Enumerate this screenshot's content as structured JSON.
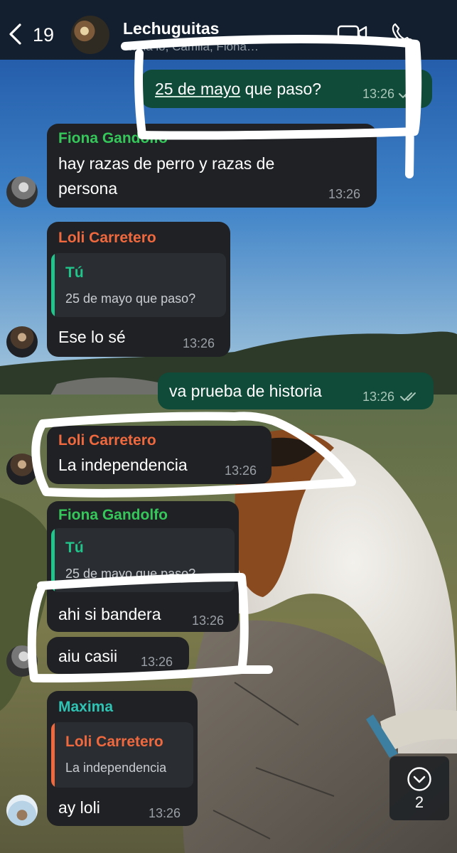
{
  "header": {
    "back_count": "19",
    "title": "Lechuguitas",
    "members": "…ula lo, Camila, Fiona…"
  },
  "colors": {
    "incoming_bubble": "#1f2124",
    "outgoing_bubble": "#0f4b38",
    "fiona": "#35c75a",
    "loli": "#f0693e",
    "maxima": "#2fc3b4",
    "reply_you": "#21c48a"
  },
  "messages": [
    {
      "type": "outgoing",
      "link_text": "25 de mayo",
      "text": " que paso?",
      "time": "13:26",
      "status": "read"
    },
    {
      "type": "incoming",
      "sender": "Fiona Gandolfo",
      "text_line1": "hay razas de perro y razas de",
      "text_line2": "persona",
      "time": "13:26"
    },
    {
      "type": "incoming",
      "sender": "Loli Carretero",
      "reply_author": "Tú",
      "reply_text": "25 de mayo que paso?",
      "text": "Ese lo sé",
      "time": "13:26"
    },
    {
      "type": "outgoing",
      "text": "va prueba de historia",
      "time": "13:26",
      "status": "read"
    },
    {
      "type": "incoming",
      "sender": "Loli Carretero",
      "text": "La independencia",
      "time": "13:26"
    },
    {
      "type": "incoming",
      "sender": "Fiona Gandolfo",
      "reply_author": "Tú",
      "reply_text": "25 de mayo que paso?",
      "text": "ahi si bandera",
      "time": "13:26"
    },
    {
      "type": "incoming",
      "text": "aiu casii",
      "time": "13:26"
    },
    {
      "type": "incoming",
      "sender": "Maxima",
      "reply_author": "Loli Carretero",
      "reply_text": "La independencia",
      "text": "ay loli",
      "time": "13:26"
    }
  ],
  "scroll_button": {
    "icon": "chevron-down-icon",
    "unread_count": "2"
  },
  "icons": [
    "chevron-left-icon",
    "video-camera-icon",
    "phone-icon",
    "double-check-icon",
    "chevron-down-icon"
  ]
}
